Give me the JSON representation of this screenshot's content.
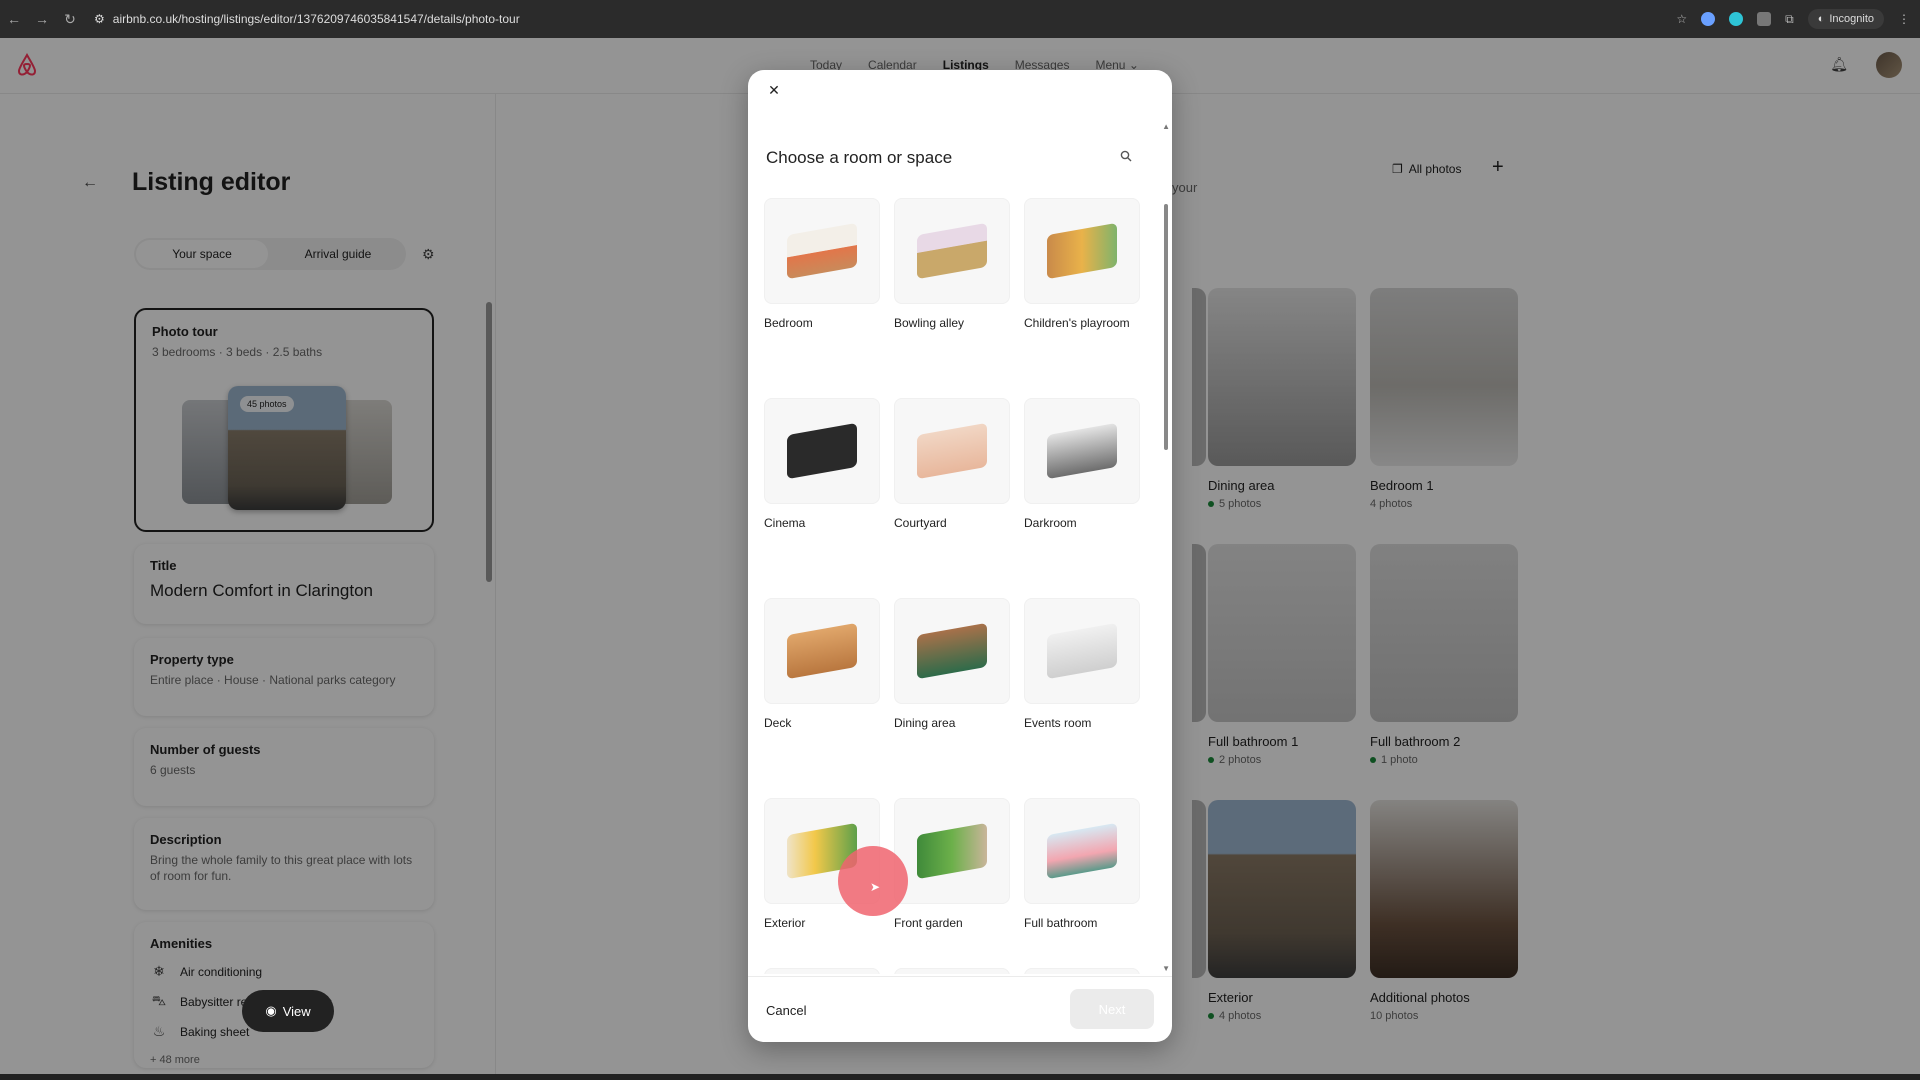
{
  "browser": {
    "url": "airbnb.co.uk/hosting/listings/editor/1376209746035841547/details/photo-tour",
    "incognito_label": "Incognito"
  },
  "topnav": {
    "links": [
      "Today",
      "Calendar",
      "Listings",
      "Messages",
      "Menu"
    ],
    "active": "Listings"
  },
  "editor": {
    "title": "Listing editor",
    "tabs": [
      "Your space",
      "Arrival guide"
    ],
    "photo_tour": {
      "label": "Photo tour",
      "summary": "3 bedrooms · 3 beds · 2.5 baths",
      "photo_count": "45 photos"
    },
    "title_card": {
      "label": "Title",
      "value": "Modern Comfort in Clarington"
    },
    "property_type": {
      "label": "Property type",
      "value": "Entire place · House · National parks category"
    },
    "guests": {
      "label": "Number of guests",
      "value": "6 guests"
    },
    "description": {
      "label": "Description",
      "value": "Bring the whole family to this great place with lots of room for fun."
    },
    "amenities": {
      "label": "Amenities",
      "items": [
        "Air conditioning",
        "Babysitter recommendations",
        "Baking sheet"
      ],
      "more": "+ 48 more"
    },
    "view_button": "View"
  },
  "photos_panel": {
    "all_photos": "All photos",
    "partial_text": "your",
    "tiles": [
      {
        "name": "Dining area",
        "count": "5 photos",
        "dot": true
      },
      {
        "name": "Bedroom 1",
        "count": "4 photos",
        "dot": false
      },
      {
        "name": "Full bathroom 1",
        "count": "2 photos",
        "dot": true
      },
      {
        "name": "Full bathroom 2",
        "count": "1 photo",
        "dot": true
      },
      {
        "name": "Exterior",
        "count": "4 photos",
        "dot": true
      },
      {
        "name": "Additional photos",
        "count": "10 photos",
        "dot": false
      }
    ]
  },
  "modal": {
    "title": "Choose a room or space",
    "rooms": [
      "Bedroom",
      "Bowling alley",
      "Children's playroom",
      "Cinema",
      "Courtyard",
      "Darkroom",
      "Deck",
      "Dining area",
      "Events room",
      "Exterior",
      "Front garden",
      "Full bathroom"
    ],
    "cancel": "Cancel",
    "next": "Next"
  },
  "colors": {
    "brand": "#ff385c",
    "status_dot": "#1a8a3a"
  }
}
